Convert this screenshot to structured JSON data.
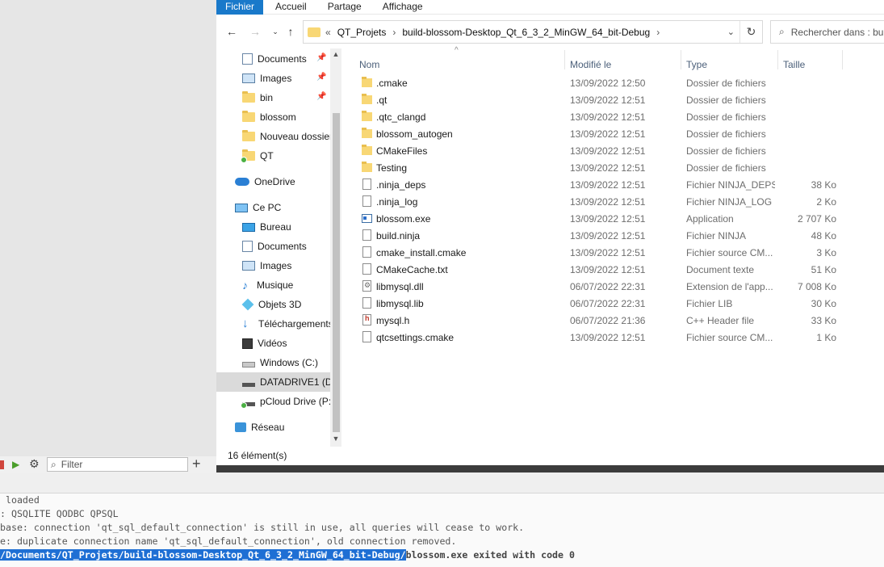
{
  "ribbon": {
    "tabs": [
      "Fichier",
      "Accueil",
      "Partage",
      "Affichage"
    ]
  },
  "address": {
    "root_chevron": "«",
    "parts": [
      "QT_Projets",
      "build-blossom-Desktop_Qt_6_3_2_MinGW_64_bit-Debug"
    ]
  },
  "search": {
    "placeholder": "Rechercher dans : bu"
  },
  "navpane": {
    "items": [
      {
        "label": "Documents",
        "icon": "documents-icon",
        "pinned": true
      },
      {
        "label": "Images",
        "icon": "images-icon",
        "pinned": true
      },
      {
        "label": "bin",
        "icon": "folder-icon",
        "pinned": true
      },
      {
        "label": "blossom",
        "icon": "folder-icon",
        "pinned": false
      },
      {
        "label": "Nouveau dossier",
        "icon": "folder-icon",
        "pinned": false
      },
      {
        "label": "QT",
        "icon": "folder-synced-icon",
        "pinned": false
      },
      {
        "label": "OneDrive",
        "icon": "onedrive-icon"
      },
      {
        "label": "Ce PC",
        "icon": "computer-icon"
      },
      {
        "label": "Bureau",
        "icon": "desktop-icon"
      },
      {
        "label": "Documents",
        "icon": "documents-icon"
      },
      {
        "label": "Images",
        "icon": "images-icon"
      },
      {
        "label": "Musique",
        "icon": "music-icon"
      },
      {
        "label": "Objets 3D",
        "icon": "3d-objects-icon"
      },
      {
        "label": "Téléchargements",
        "icon": "downloads-icon"
      },
      {
        "label": "Vidéos",
        "icon": "videos-icon"
      },
      {
        "label": "Windows  (C:)",
        "icon": "windows-drive-icon"
      },
      {
        "label": "DATADRIVE1 (D:)",
        "icon": "drive-icon",
        "selected": true
      },
      {
        "label": "pCloud Drive (P:)",
        "icon": "pcloud-drive-icon"
      },
      {
        "label": "Réseau",
        "icon": "network-icon"
      }
    ]
  },
  "filelist": {
    "columns": {
      "name": "Nom",
      "modified": "Modifié le",
      "type": "Type",
      "size": "Taille"
    },
    "rows": [
      {
        "name": ".cmake",
        "date": "13/09/2022 12:50",
        "type": "Dossier de fichiers",
        "size": "",
        "icon": "folder-icon"
      },
      {
        "name": ".qt",
        "date": "13/09/2022 12:51",
        "type": "Dossier de fichiers",
        "size": "",
        "icon": "folder-icon"
      },
      {
        "name": ".qtc_clangd",
        "date": "13/09/2022 12:51",
        "type": "Dossier de fichiers",
        "size": "",
        "icon": "folder-icon"
      },
      {
        "name": "blossom_autogen",
        "date": "13/09/2022 12:51",
        "type": "Dossier de fichiers",
        "size": "",
        "icon": "folder-icon"
      },
      {
        "name": "CMakeFiles",
        "date": "13/09/2022 12:51",
        "type": "Dossier de fichiers",
        "size": "",
        "icon": "folder-icon"
      },
      {
        "name": "Testing",
        "date": "13/09/2022 12:51",
        "type": "Dossier de fichiers",
        "size": "",
        "icon": "folder-icon"
      },
      {
        "name": ".ninja_deps",
        "date": "13/09/2022 12:51",
        "type": "Fichier NINJA_DEPS",
        "size": "38 Ko",
        "icon": "file-icon"
      },
      {
        "name": ".ninja_log",
        "date": "13/09/2022 12:51",
        "type": "Fichier NINJA_LOG",
        "size": "2 Ko",
        "icon": "file-icon"
      },
      {
        "name": "blossom.exe",
        "date": "13/09/2022 12:51",
        "type": "Application",
        "size": "2 707 Ko",
        "icon": "exe-icon"
      },
      {
        "name": "build.ninja",
        "date": "13/09/2022 12:51",
        "type": "Fichier NINJA",
        "size": "48 Ko",
        "icon": "file-icon"
      },
      {
        "name": "cmake_install.cmake",
        "date": "13/09/2022 12:51",
        "type": "Fichier source CM...",
        "size": "3 Ko",
        "icon": "file-icon"
      },
      {
        "name": "CMakeCache.txt",
        "date": "13/09/2022 12:51",
        "type": "Document texte",
        "size": "51 Ko",
        "icon": "file-icon"
      },
      {
        "name": "libmysql.dll",
        "date": "06/07/2022 22:31",
        "type": "Extension de l'app...",
        "size": "7 008 Ko",
        "icon": "dll-icon"
      },
      {
        "name": "libmysql.lib",
        "date": "06/07/2022 22:31",
        "type": "Fichier LIB",
        "size": "30 Ko",
        "icon": "file-icon"
      },
      {
        "name": "mysql.h",
        "date": "06/07/2022 21:36",
        "type": "C++ Header file",
        "size": "33 Ko",
        "icon": "header-icon"
      },
      {
        "name": "qtcsettings.cmake",
        "date": "13/09/2022 12:51",
        "type": "Fichier source CM...",
        "size": "1 Ko",
        "icon": "file-icon"
      }
    ]
  },
  "status": {
    "count": "16 élément(s)"
  },
  "ide": {
    "filter_placeholder": "Filter",
    "output_lines": [
      " loaded",
      ": QSQLITE QODBC QPSQL",
      "base: connection 'qt_sql_default_connection' is still in use, all queries will cease to work.",
      "e: duplicate connection name 'qt_sql_default_connection', old connection removed."
    ],
    "output_selected": "/Documents/QT_Projets/build-blossom-Desktop_Qt_6_3_2_MinGW_64_bit-Debug/",
    "output_tail": "blossom.exe exited with code 0"
  }
}
